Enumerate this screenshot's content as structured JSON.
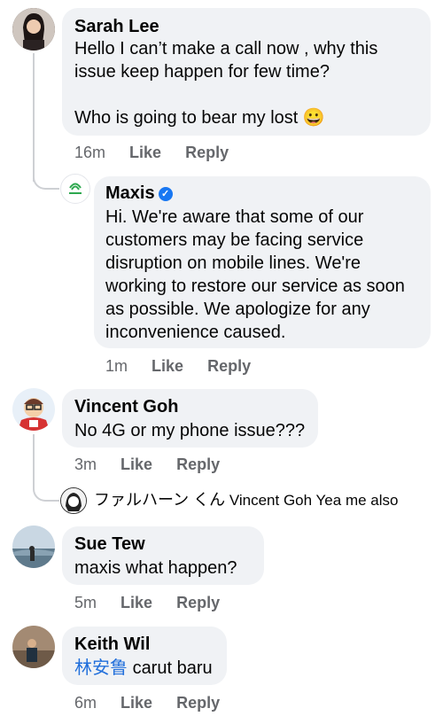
{
  "comments": [
    {
      "name": "Sarah Lee",
      "text_lines": [
        "Hello I can’t make a call now , why this",
        "issue keep happen for few time?",
        "",
        "Who is going to bear my lost 😀"
      ],
      "time": "16m",
      "like": "Like",
      "reply": "Reply"
    },
    {
      "name": "Maxis",
      "verified": true,
      "text_lines": [
        "Hi. We're aware that some of our",
        "customers may be facing service",
        "disruption on mobile lines. We're",
        "working to restore our service as soon",
        "as possible. We apologize for any",
        "inconvenience caused."
      ],
      "time": "1m",
      "like": "Like",
      "reply": "Reply"
    },
    {
      "name": "Vincent Goh",
      "text_lines": [
        "No 4G or my phone issue???"
      ],
      "time": "3m",
      "like": "Like",
      "reply": "Reply"
    },
    {
      "name": "ファルハーン くん",
      "mention": "Vincent Goh",
      "text": "Yea me also"
    },
    {
      "name": "Sue Tew",
      "text_lines": [
        "maxis what happen?"
      ],
      "time": "5m",
      "like": "Like",
      "reply": "Reply"
    },
    {
      "name": "Keith Wil",
      "mention": "林安鲁",
      "text": "carut baru",
      "time": "6m",
      "like": "Like",
      "reply": "Reply"
    }
  ],
  "colors": {
    "bubble": "#f0f2f5",
    "meta": "#65676b",
    "link": "#216fdb",
    "verified": "#1877f2",
    "maxis_green": "#2ea84f"
  },
  "icons": {
    "verified": "verified-badge-icon"
  }
}
